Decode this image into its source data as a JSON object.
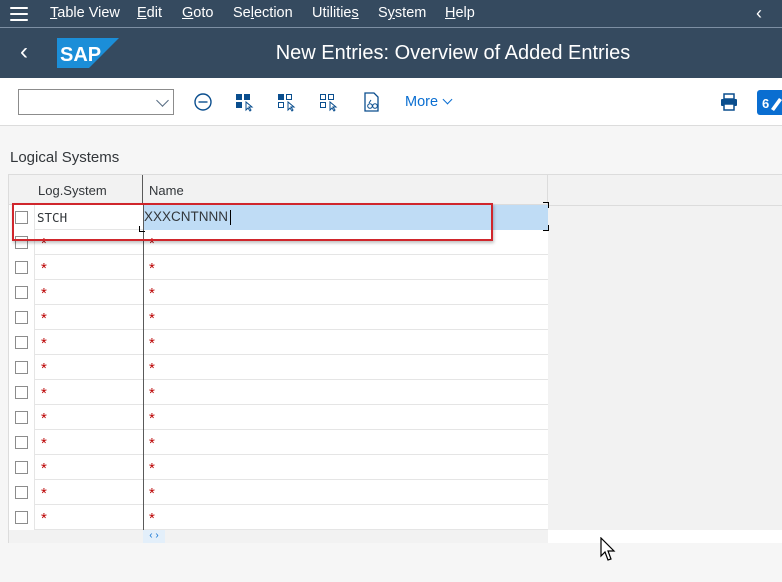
{
  "menubar": {
    "items": [
      {
        "label": "Table View",
        "mnemonic": "T"
      },
      {
        "label": "Edit",
        "mnemonic": "E"
      },
      {
        "label": "Goto",
        "mnemonic": "G"
      },
      {
        "label": "Selection",
        "mnemonic": "l"
      },
      {
        "label": "Utilities",
        "mnemonic": "s"
      },
      {
        "label": "System",
        "mnemonic": "y"
      },
      {
        "label": "Help",
        "mnemonic": "H"
      }
    ],
    "collapse_icon": "chevron-left-icon"
  },
  "shell": {
    "back_icon": "back-arrow-icon",
    "logo_text": "SAP",
    "title": "New Entries: Overview of Added Entries"
  },
  "toolbar": {
    "dropdown_value": "",
    "icons": [
      "delete-icon",
      "select-all-icon",
      "select-block-icon",
      "deselect-all-icon",
      "display-details-icon"
    ],
    "more_label": "More",
    "print_icon": "print-icon",
    "edit_icon": "customize-icon"
  },
  "section": {
    "title": "Logical Systems"
  },
  "table": {
    "columns": [
      "Log.System",
      "Name"
    ],
    "rows": [
      {
        "log_system": "STCH",
        "name": "XXXCNTNNN",
        "active": true
      },
      {
        "log_system": "*",
        "name": "*"
      },
      {
        "log_system": "*",
        "name": "*"
      },
      {
        "log_system": "*",
        "name": "*"
      },
      {
        "log_system": "*",
        "name": "*"
      },
      {
        "log_system": "*",
        "name": "*"
      },
      {
        "log_system": "*",
        "name": "*"
      },
      {
        "log_system": "*",
        "name": "*"
      },
      {
        "log_system": "*",
        "name": "*"
      },
      {
        "log_system": "*",
        "name": "*"
      },
      {
        "log_system": "*",
        "name": "*"
      },
      {
        "log_system": "*",
        "name": "*"
      },
      {
        "log_system": "*",
        "name": "*"
      }
    ],
    "scroll_label": "‹ ›"
  },
  "colors": {
    "shell": "#354a5f",
    "accent": "#0a6ed1",
    "required": "#bb0000",
    "selection": "#bfdcf5",
    "annotation": "#d0262c"
  }
}
